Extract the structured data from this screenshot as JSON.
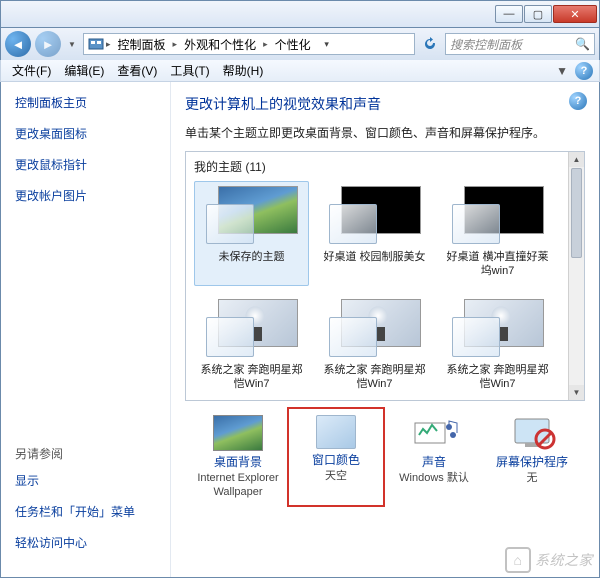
{
  "window": {
    "min": "—",
    "max": "▢",
    "close": "✕"
  },
  "breadcrumb": {
    "seg1": "控制面板",
    "seg2": "外观和个性化",
    "seg3": "个性化"
  },
  "search": {
    "placeholder": "搜索控制面板"
  },
  "menu": {
    "file": "文件(F)",
    "edit": "编辑(E)",
    "view": "查看(V)",
    "tools": "工具(T)",
    "help": "帮助(H)"
  },
  "sidebar": {
    "home": "控制面板主页",
    "links": [
      "更改桌面图标",
      "更改鼠标指针",
      "更改帐户图片"
    ],
    "see_also": "另请参阅",
    "see_links": [
      "显示",
      "任务栏和「开始」菜单",
      "轻松访问中心"
    ]
  },
  "main": {
    "title": "更改计算机上的视觉效果和声音",
    "subtitle": "单击某个主题立即更改桌面背景、窗口颜色、声音和屏幕保护程序。",
    "group_label": "我的主题 (11)",
    "themes": [
      {
        "name": "未保存的主题",
        "kind": "landscape",
        "selected": true
      },
      {
        "name": "好桌道 校园制服美女",
        "kind": "dark"
      },
      {
        "name": "好桌道 横冲直撞好莱坞win7",
        "kind": "dark"
      },
      {
        "name": "系统之家 奔跑明星郑恺Win7",
        "kind": "run"
      },
      {
        "name": "系统之家 奔跑明星郑恺Win7",
        "kind": "run"
      },
      {
        "name": "系统之家 奔跑明星郑恺Win7",
        "kind": "run"
      }
    ]
  },
  "bottom": {
    "bg": {
      "title": "桌面背景",
      "value": "Internet Explorer Wallpaper"
    },
    "color": {
      "title": "窗口颜色",
      "value": "天空"
    },
    "sound": {
      "title": "声音",
      "value": "Windows 默认"
    },
    "saver": {
      "title": "屏幕保护程序",
      "value": "无"
    }
  },
  "watermark": "系统之家"
}
